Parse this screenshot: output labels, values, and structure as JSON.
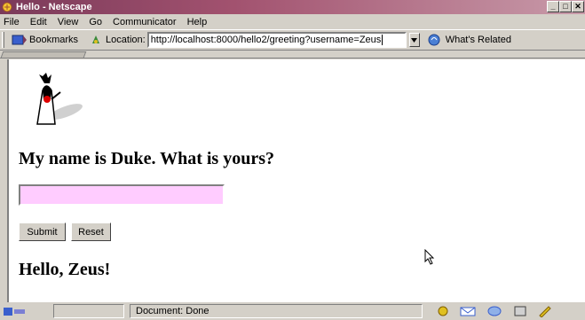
{
  "window": {
    "title": "Hello - Netscape",
    "minimize_glyph": "_",
    "maximize_glyph": "□",
    "close_glyph": "✕"
  },
  "menu": {
    "items": [
      {
        "label": "File"
      },
      {
        "label": "Edit"
      },
      {
        "label": "View"
      },
      {
        "label": "Go"
      },
      {
        "label": "Communicator"
      },
      {
        "label": "Help"
      }
    ]
  },
  "location_bar": {
    "bookmarks_label": "Bookmarks",
    "location_label": "Location:",
    "url": "http://localhost:8000/hello2/greeting?username=Zeus",
    "related_label": "What's Related"
  },
  "page": {
    "question": "My name is Duke. What is yours?",
    "name_input_value": "",
    "submit_label": "Submit",
    "reset_label": "Reset",
    "greeting": "Hello, Zeus!",
    "input_bg_color": "#ffccff"
  },
  "status": {
    "text": "Document: Done"
  },
  "colors": {
    "titlebar": "#7b3a5a",
    "chrome": "#d4d0c8"
  },
  "icons": [
    "netscape-app-icon",
    "bookmarks-icon",
    "location-icon",
    "whats-related-icon",
    "duke-mascot-icon",
    "mouse-pointer-icon",
    "security-lock-icon",
    "component-icons"
  ]
}
